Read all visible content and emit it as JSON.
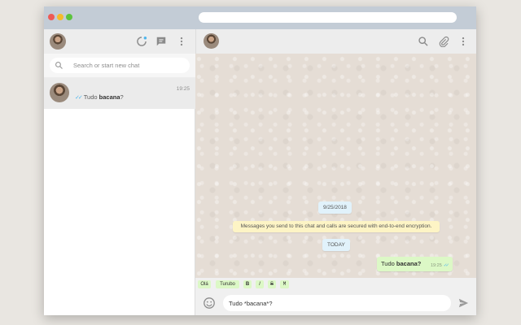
{
  "sidebar": {
    "search_placeholder": "Search or start new chat",
    "chats": [
      {
        "preview_text": "Tudo ",
        "preview_bold": "bacana",
        "preview_end": "?",
        "time": "19:25"
      }
    ]
  },
  "conversation": {
    "date_label": "9/25/2018",
    "encryption_notice": "Messages you send to this chat and calls are secured with end-to-end encryption.",
    "today_label": "TODAY",
    "messages": [
      {
        "text": "Tudo ",
        "bold": "bacana?",
        "time": "19:25",
        "status": "read"
      }
    ]
  },
  "format_bar": {
    "chips": [
      "Olá",
      "Turubo",
      "B",
      "I",
      "S",
      "M"
    ]
  },
  "composer": {
    "value": "Tudo *bacana*?"
  },
  "icons": {
    "header_left": [
      "status-icon",
      "new-chat-icon",
      "menu-icon"
    ],
    "header_right": [
      "search-icon",
      "attach-icon",
      "menu-icon"
    ],
    "composer": [
      "emoji-icon",
      "send-icon"
    ]
  },
  "colors": {
    "accent_ticks": "#4fb6ec",
    "outgoing_bubble": "#dcf8c6",
    "chat_background": "#e5ddd5",
    "encryption_banner": "#fdf4c5"
  }
}
